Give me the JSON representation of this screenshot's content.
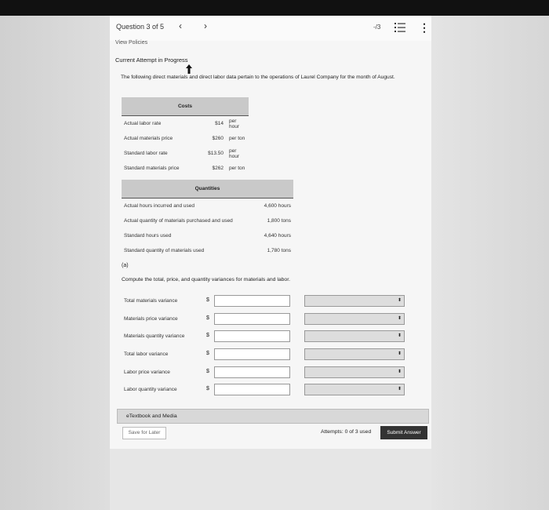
{
  "header": {
    "question_label": "Question 3 of 5",
    "prev_glyph": "‹",
    "next_glyph": "›",
    "score": "-/3",
    "more_glyph": "⋮"
  },
  "main": {
    "view_policies": "View Policies",
    "attempt_title": "Current Attempt in Progress",
    "intro": "The following direct materials and direct labor data pertain to the operations of Laurel Company for the month of August."
  },
  "costs": {
    "title": "Costs",
    "rows": [
      {
        "label": "Actual labor rate",
        "value": "$14",
        "unit": "per hour"
      },
      {
        "label": "Actual materials price",
        "value": "$260",
        "unit": "per ton"
      },
      {
        "label": "Standard labor rate",
        "value": "$13.50",
        "unit": "per hour"
      },
      {
        "label": "Standard materials price",
        "value": "$262",
        "unit": "per ton"
      }
    ]
  },
  "quantities": {
    "title": "Quantities",
    "rows": [
      {
        "label": "Actual hours incurred and used",
        "value": "4,600 hours"
      },
      {
        "label": "Actual quantity of materials purchased and used",
        "value": "1,800 tons"
      },
      {
        "label": "Standard hours used",
        "value": "4,640 hours"
      },
      {
        "label": "Standard quantity of materials used",
        "value": "1,780 tons"
      }
    ]
  },
  "part_a": {
    "label": "(a)",
    "instruction": "Compute the total, price, and quantity variances for materials and labor.",
    "currency": "$",
    "rows": [
      {
        "label": "Total materials variance",
        "value": "",
        "select": ""
      },
      {
        "label": "Materials price variance",
        "value": "",
        "select": ""
      },
      {
        "label": "Materials quantity variance",
        "value": "",
        "select": ""
      },
      {
        "label": "Total labor variance",
        "value": "",
        "select": ""
      },
      {
        "label": "Labor price variance",
        "value": "",
        "select": ""
      },
      {
        "label": "Labor quantity variance",
        "value": "",
        "select": ""
      }
    ]
  },
  "footer": {
    "etextbook": "eTextbook and Media",
    "save_label": "Save for Later",
    "attempts": "Attempts: 0 of 3 used",
    "submit_label": "Submit Answer"
  },
  "colors": {
    "submit_bg": "#333333",
    "table_header_bg": "#c9c9c9"
  }
}
